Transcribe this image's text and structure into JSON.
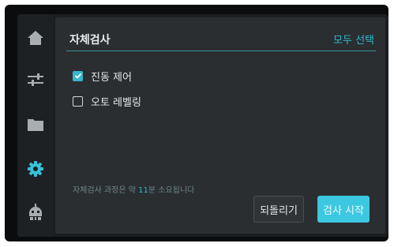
{
  "sidebar": {
    "items": [
      {
        "icon": "home-icon",
        "active": false
      },
      {
        "icon": "sliders-icon",
        "active": false
      },
      {
        "icon": "folder-icon",
        "active": false
      },
      {
        "icon": "gear-icon",
        "active": true
      },
      {
        "icon": "robot-icon",
        "active": false
      }
    ],
    "active_color": "#38c1d8",
    "inactive_color": "#a9aeb1"
  },
  "panel": {
    "title": "자체검사",
    "select_all_label": "모두 선택",
    "options": [
      {
        "label": "진동 제어",
        "checked": true
      },
      {
        "label": "오토 레벨링",
        "checked": false
      }
    ],
    "info_prefix": "자체검사 과정은 약 ",
    "info_minutes": "11",
    "info_suffix": "분 소요됩니다",
    "revert_label": "되돌리기",
    "start_label": "검사 시작"
  },
  "colors": {
    "accent": "#38b6cc",
    "panel_bg": "#2a2e31",
    "screen_bg": "#1b1e20"
  }
}
